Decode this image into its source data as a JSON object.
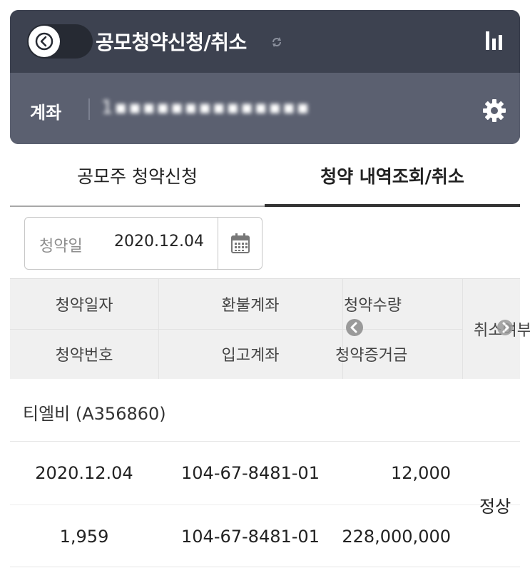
{
  "header": {
    "title": "공모청약신청/취소",
    "account_label": "계좌",
    "account_number": "1▪▪▪▪▪▪▪▪▪▪▪▪▪▪"
  },
  "tabs": [
    {
      "label": "공모주 청약신청",
      "active": false
    },
    {
      "label": "청약 내역조회/취소",
      "active": true
    }
  ],
  "filter": {
    "date_label": "청약일",
    "date_value": "2020.12.04"
  },
  "table": {
    "headers": {
      "row1": [
        "청약일자",
        "환불계좌",
        "청약수량"
      ],
      "row2": [
        "청약번호",
        "입고계좌",
        "청약증거금"
      ],
      "status_col": "취소여부"
    },
    "group": {
      "stock_name": "티엘비 (A356860)",
      "rows": [
        [
          "2020.12.04",
          "104-67-8481-01",
          "12,000"
        ],
        [
          "1,959",
          "104-67-8481-01",
          "228,000,000"
        ]
      ],
      "status": "정상"
    }
  },
  "colors": {
    "header_dark": "#3d4250",
    "header_light": "#5b6070",
    "table_header_bg": "#f0f0f0",
    "active_tab_line": "#333333"
  },
  "icons": [
    "back-arrow-icon",
    "refresh-icon",
    "bar-chart-icon",
    "gear-icon",
    "calendar-icon",
    "scroll-left-icon",
    "scroll-right-icon"
  ]
}
